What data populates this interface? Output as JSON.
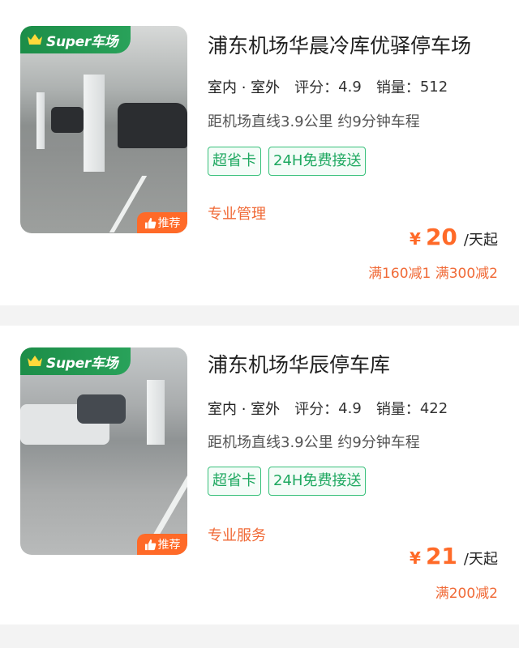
{
  "lots": [
    {
      "badge": "Super车场",
      "recommend": "推荐",
      "title": "浦东机场华晨冷库优驿停车场",
      "location": "室内 · 室外",
      "rating_label": "评分：",
      "rating": "4.9",
      "sales_label": "销量：",
      "sales": "512",
      "distance": "距机场直线3.9公里 约9分钟车程",
      "tags": [
        "超省卡",
        "24H免费接送"
      ],
      "feature": "专业管理",
      "currency": "¥",
      "price": "20",
      "price_unit": "/天起",
      "promo": "满160减1 满300减2"
    },
    {
      "badge": "Super车场",
      "recommend": "推荐",
      "title": "浦东机场华辰停车库",
      "location": "室内 · 室外",
      "rating_label": "评分：",
      "rating": "4.9",
      "sales_label": "销量：",
      "sales": "422",
      "distance": "距机场直线3.9公里 约9分钟车程",
      "tags": [
        "超省卡",
        "24H免费接送"
      ],
      "feature": "专业服务",
      "currency": "¥",
      "price": "21",
      "price_unit": "/天起",
      "promo": "满200减2"
    }
  ],
  "colors": {
    "brand_green": "#1c8d48",
    "accent_orange": "#ff6a28",
    "tag_green": "#1ea860"
  },
  "icons": {
    "badge": "crown-icon",
    "recommend": "thumbs-up-icon"
  }
}
